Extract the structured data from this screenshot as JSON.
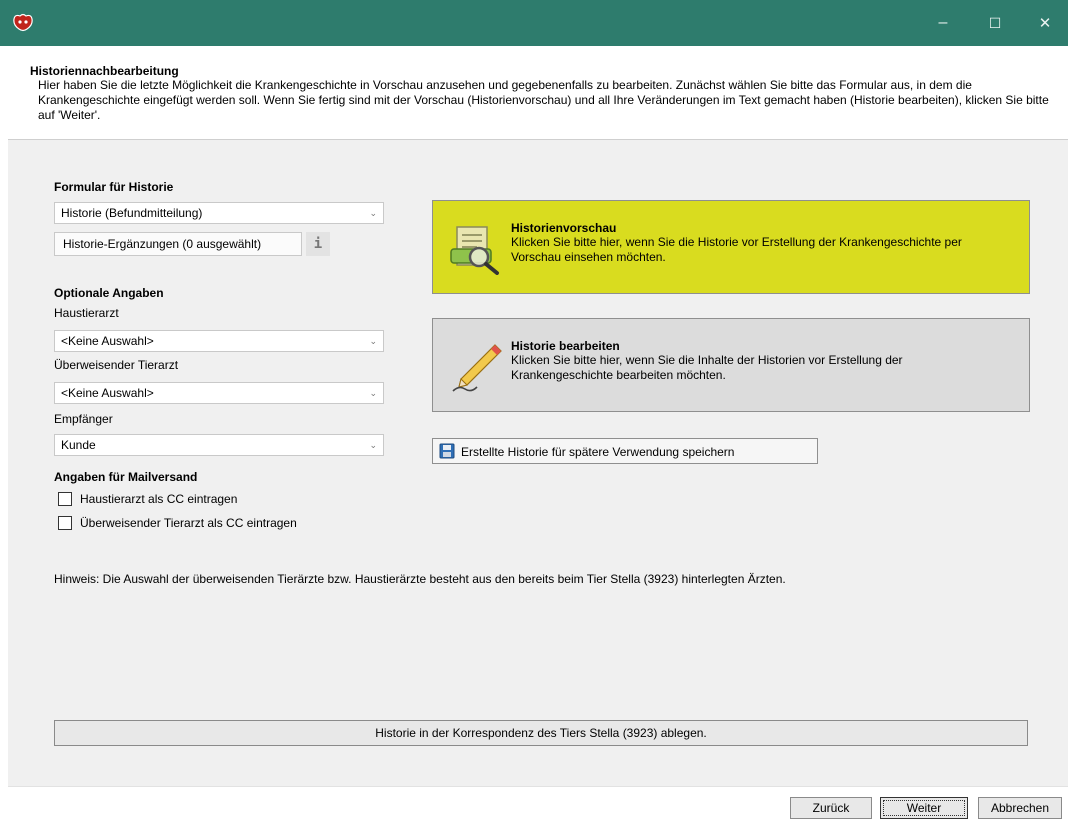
{
  "window": {
    "minimize_glyph": "–",
    "maximize_glyph": "☐",
    "close_glyph": "✕",
    "titlebar_color": "#2e7c6d"
  },
  "header": {
    "title": "Historiennachbearbeitung",
    "description": "Hier haben Sie die letzte Möglichkeit die Krankengeschichte in Vorschau anzusehen und gegebenenfalls zu bearbeiten. Zunächst wählen Sie bitte das Formular aus, in dem die Krankengeschichte eingefügt werden soll. Wenn Sie fertig sind mit der Vorschau (Historienvorschau) und all Ihre Veränderungen im Text gemacht haben (Historie bearbeiten), klicken Sie bitte auf 'Weiter'."
  },
  "form": {
    "section_label": "Formular für Historie",
    "formular_value": "Historie (Befundmitteilung)",
    "ergaenzungen_label": "Historie-Ergänzungen (0 ausgewählt)",
    "info_glyph": "i"
  },
  "optional": {
    "section_label": "Optionale Angaben",
    "haustierarzt_label": "Haustierarzt",
    "haustierarzt_value": "<Keine Auswahl>",
    "ueberweisender_label": "Überweisender Tierarzt",
    "ueberweisender_value": "<Keine Auswahl>",
    "empfaenger_label": "Empfänger",
    "empfaenger_value": "Kunde"
  },
  "mail": {
    "section_label": "Angaben für Mailversand",
    "cc_haustierarzt": "Haustierarzt als CC eintragen",
    "cc_ueberweisender": "Überweisender Tierarzt als CC eintragen"
  },
  "panels": {
    "preview": {
      "title": "Historienvorschau",
      "text": "Klicken Sie bitte hier, wenn Sie die Historie vor Erstellung der Krankengeschichte per Vorschau einsehen möchten.",
      "color": "#d9dc1f"
    },
    "edit": {
      "title": "Historie bearbeiten",
      "text": "Klicken Sie bitte hier, wenn Sie die Inhalte der Historien vor Erstellung der Krankengeschichte bearbeiten möchten.",
      "color": "#dcdcdc"
    },
    "save_label": "Erstellte Historie für spätere Verwendung speichern"
  },
  "hint": "Hinweis: Die Auswahl der überweisenden Tierärzte bzw. Haustierärzte besteht aus den bereits beim Tier Stella (3923)  hinterlegten Ärzten.",
  "archive_label": "Historie in der Korrespondenz des Tiers  Stella (3923)  ablegen.",
  "footer": {
    "back": "Zurück",
    "next": "Weiter",
    "cancel": "Abbrechen"
  }
}
